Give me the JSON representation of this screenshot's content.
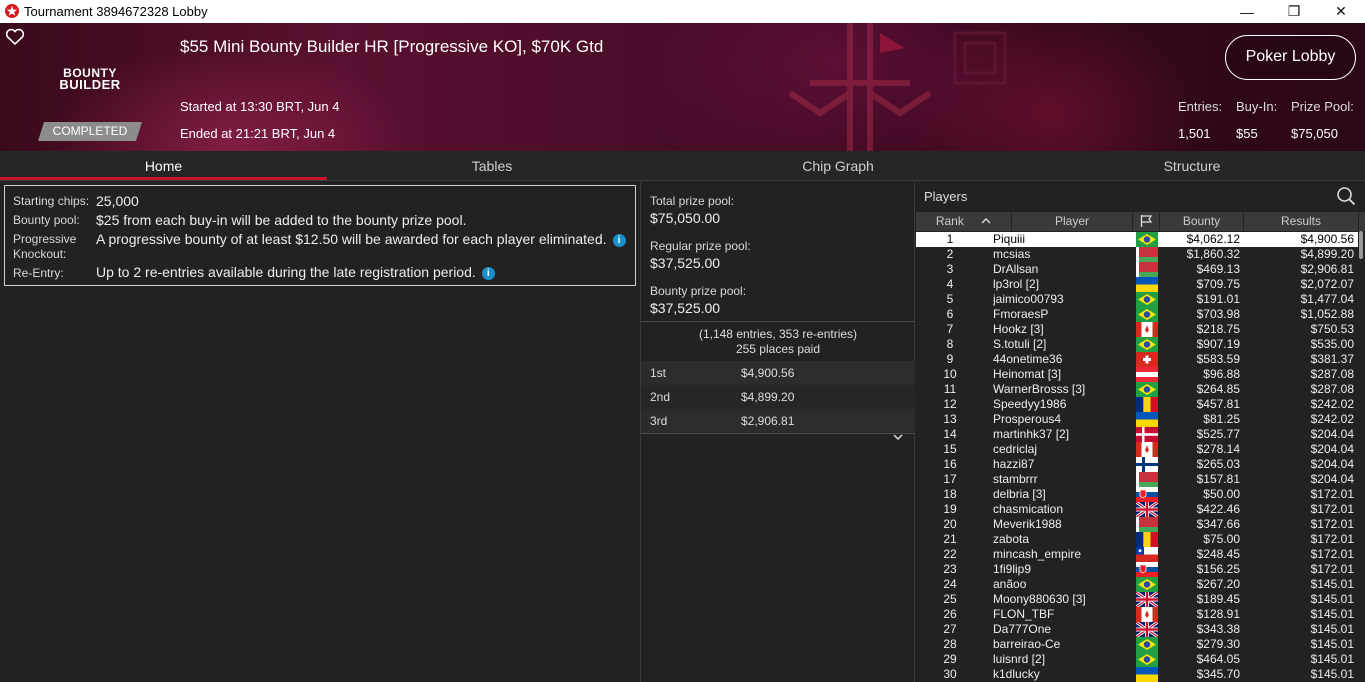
{
  "window": {
    "title": "Tournament 3894672328 Lobby",
    "minimize": "—",
    "maximize": "❐",
    "close": "✕"
  },
  "banner": {
    "logo_line1": "BOUNTY",
    "logo_line2": "BUILDER",
    "status": "COMPLETED",
    "title": "$55 Mini Bounty Builder HR [Progressive KO], $70K Gtd",
    "started": "Started at 13:30 BRT, Jun 4",
    "ended": "Ended at 21:21 BRT, Jun 4",
    "lobby_button": "Poker Lobby",
    "entries_label": "Entries:",
    "entries_value": "1,501",
    "buyin_label": "Buy-In:",
    "buyin_value": "$55",
    "prizepool_label": "Prize Pool:",
    "prizepool_value": "$75,050"
  },
  "tabs": [
    {
      "label": "Home",
      "active": true
    },
    {
      "label": "Tables",
      "active": false
    },
    {
      "label": "Chip Graph",
      "active": false
    },
    {
      "label": "Structure",
      "active": false
    }
  ],
  "info": {
    "starting_chips_label": "Starting chips:",
    "starting_chips_value": "25,000",
    "bounty_pool_label": "Bounty pool:",
    "bounty_pool_value": "$25 from each buy-in will be added to the bounty prize pool.",
    "progressive_label_1": "Progressive",
    "progressive_label_2": "Knockout:",
    "progressive_value": "A progressive bounty of at least $12.50 will be awarded for each player eliminated.",
    "reentry_label": "Re-Entry:",
    "reentry_value": "Up to 2 re-entries available during the late registration period.",
    "info_glyph": "i"
  },
  "prize": {
    "total_label": "Total prize pool:",
    "total_value": "$75,050.00",
    "regular_label": "Regular prize pool:",
    "regular_value": "$37,525.00",
    "bounty_label": "Bounty prize pool:",
    "bounty_value": "$37,525.00",
    "entries_note": "(1,148 entries, 353 re-entries)",
    "places_paid": "255 places paid",
    "payouts": [
      {
        "place": "1st",
        "amount": "$4,900.56"
      },
      {
        "place": "2nd",
        "amount": "$4,899.20"
      },
      {
        "place": "3rd",
        "amount": "$2,906.81"
      }
    ]
  },
  "players": {
    "title": "Players",
    "col_rank": "Rank",
    "col_player": "Player",
    "col_bounty": "Bounty",
    "col_results": "Results",
    "selected_rank": 1,
    "rows": [
      {
        "rank": "1",
        "name": "Piquiii",
        "flag": "br",
        "bounty": "$4,062.12",
        "results": "$4,900.56"
      },
      {
        "rank": "2",
        "name": "mcsias",
        "flag": "by",
        "bounty": "$1,860.32",
        "results": "$4,899.20"
      },
      {
        "rank": "3",
        "name": "DrAllsan",
        "flag": "by",
        "bounty": "$469.13",
        "results": "$2,906.81"
      },
      {
        "rank": "4",
        "name": "lp3rol [2]",
        "flag": "ua",
        "bounty": "$709.75",
        "results": "$2,072.07"
      },
      {
        "rank": "5",
        "name": "jaimico00793",
        "flag": "br",
        "bounty": "$191.01",
        "results": "$1,477.04"
      },
      {
        "rank": "6",
        "name": "FmoraesP",
        "flag": "br",
        "bounty": "$703.98",
        "results": "$1,052.88"
      },
      {
        "rank": "7",
        "name": "Hookz [3]",
        "flag": "ca",
        "bounty": "$218.75",
        "results": "$750.53"
      },
      {
        "rank": "8",
        "name": "S.totuli [2]",
        "flag": "br",
        "bounty": "$907.19",
        "results": "$535.00"
      },
      {
        "rank": "9",
        "name": "44onetime36",
        "flag": "ch",
        "bounty": "$583.59",
        "results": "$381.37"
      },
      {
        "rank": "10",
        "name": "Heinomat [3]",
        "flag": "at",
        "bounty": "$96.88",
        "results": "$287.08"
      },
      {
        "rank": "11",
        "name": "WarnerBrosss [3]",
        "flag": "br",
        "bounty": "$264.85",
        "results": "$287.08"
      },
      {
        "rank": "12",
        "name": "Speedyy1986",
        "flag": "ro",
        "bounty": "$457.81",
        "results": "$242.02"
      },
      {
        "rank": "13",
        "name": "Prosperous4",
        "flag": "ua",
        "bounty": "$81.25",
        "results": "$242.02"
      },
      {
        "rank": "14",
        "name": "martinhk37 [2]",
        "flag": "dk",
        "bounty": "$525.77",
        "results": "$204.04"
      },
      {
        "rank": "15",
        "name": "cedriclaj",
        "flag": "ca",
        "bounty": "$278.14",
        "results": "$204.04"
      },
      {
        "rank": "16",
        "name": "hazzi87",
        "flag": "fi",
        "bounty": "$265.03",
        "results": "$204.04"
      },
      {
        "rank": "17",
        "name": "stambrrr",
        "flag": "by",
        "bounty": "$157.81",
        "results": "$204.04"
      },
      {
        "rank": "18",
        "name": "delbria [3]",
        "flag": "sk",
        "bounty": "$50.00",
        "results": "$172.01"
      },
      {
        "rank": "19",
        "name": "chasmication",
        "flag": "gb",
        "bounty": "$422.46",
        "results": "$172.01"
      },
      {
        "rank": "20",
        "name": "Meverik1988",
        "flag": "by",
        "bounty": "$347.66",
        "results": "$172.01"
      },
      {
        "rank": "21",
        "name": "zabota",
        "flag": "ro",
        "bounty": "$75.00",
        "results": "$172.01"
      },
      {
        "rank": "22",
        "name": "mincash_empire",
        "flag": "cl",
        "bounty": "$248.45",
        "results": "$172.01"
      },
      {
        "rank": "23",
        "name": "1fi9lip9",
        "flag": "sk",
        "bounty": "$156.25",
        "results": "$172.01"
      },
      {
        "rank": "24",
        "name": "anãoo",
        "flag": "br",
        "bounty": "$267.20",
        "results": "$145.01"
      },
      {
        "rank": "25",
        "name": "Moony880630 [3]",
        "flag": "gb",
        "bounty": "$189.45",
        "results": "$145.01"
      },
      {
        "rank": "26",
        "name": "FLON_TBF",
        "flag": "ca",
        "bounty": "$128.91",
        "results": "$145.01"
      },
      {
        "rank": "27",
        "name": "Da777One",
        "flag": "gb",
        "bounty": "$343.38",
        "results": "$145.01"
      },
      {
        "rank": "28",
        "name": "barreirao-Ce",
        "flag": "br",
        "bounty": "$279.30",
        "results": "$145.01"
      },
      {
        "rank": "29",
        "name": "luisnrd [2]",
        "flag": "br",
        "bounty": "$464.05",
        "results": "$145.01"
      },
      {
        "rank": "30",
        "name": "k1dlucky",
        "flag": "ua",
        "bounty": "$345.70",
        "results": "$145.01"
      }
    ]
  },
  "colors": {
    "accent": "#c4122f",
    "background": "#222222",
    "info_icon": "#1b8fc7"
  }
}
